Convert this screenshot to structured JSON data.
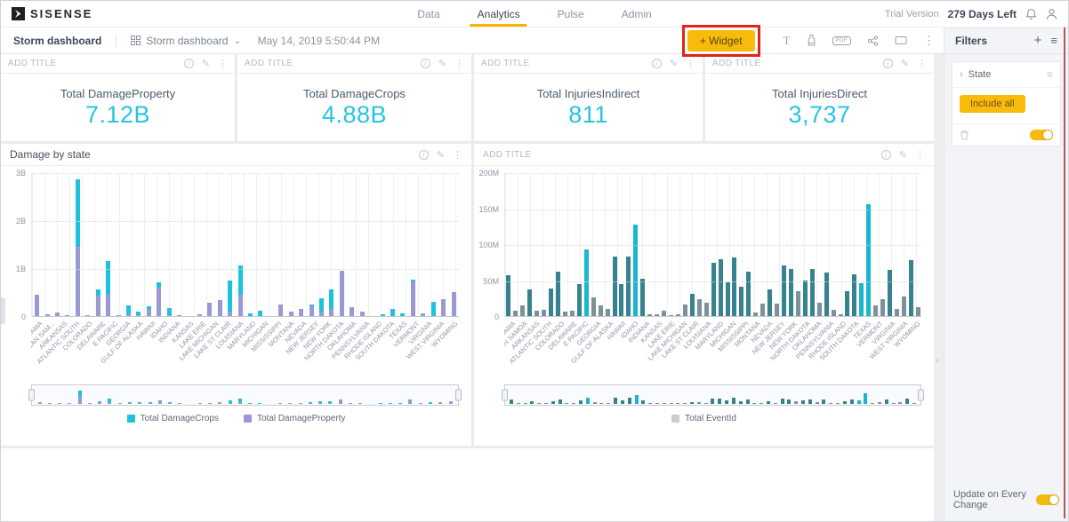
{
  "topnav": {
    "brand": "SISENSE",
    "tabs": [
      {
        "label": "Data"
      },
      {
        "label": "Analytics"
      },
      {
        "label": "Pulse"
      },
      {
        "label": "Admin"
      }
    ],
    "active_tab": "Analytics",
    "trial_label": "Trial Version",
    "trial_days": "279 Days Left"
  },
  "toolbar": {
    "breadcrumb": "Storm dashboard",
    "dashboard_selector": "Storm dashboard",
    "timestamp": "May 14, 2019 5:50:44 PM",
    "widget_button": "+ Widget"
  },
  "icons": {
    "info": "i",
    "edit": "✎",
    "dots": "⋮",
    "plus": "+",
    "hamburger": "≡",
    "caret_down": "⌄",
    "chevron_right": "›",
    "text_widget": "T",
    "pdf": "PDF"
  },
  "kpis": [
    {
      "header": "ADD TITLE",
      "label": "Total DamageProperty",
      "value": "7.12B"
    },
    {
      "header": "ADD TITLE",
      "label": "Total DamageCrops",
      "value": "4.88B"
    },
    {
      "header": "ADD TITLE",
      "label": "Total InjuriesIndirect",
      "value": "811"
    },
    {
      "header": "ADD TITLE",
      "label": "Total InjuriesDirect",
      "value": "3,737"
    }
  ],
  "filters": {
    "title": "Filters",
    "groups": [
      {
        "name": "State",
        "chip": "Include all"
      }
    ],
    "footer_label": "Update on Every Change",
    "update_on": true
  },
  "colors": {
    "accent_yellow": "#f8ba0b",
    "kpi_cyan": "#27c4e0",
    "property_purple": "#9a99d4",
    "crops_cyan": "#1dc3dc",
    "teal": "#37828f",
    "teal_gray": "#7d9298",
    "teal_bright": "#19b7cf",
    "legend_gray": "#c9ced3",
    "annotation_red": "#e3231a"
  },
  "chart_data": [
    {
      "type": "bar",
      "stacked": true,
      "title": "Damage by state",
      "ymax": 3,
      "y_unit": "B",
      "yticks": [
        "3B",
        "2B",
        "1B",
        "0"
      ],
      "grid": true,
      "legend_position": "bottom",
      "categories": [
        "ALABAMA",
        "AMERICAN SAM...",
        "ARKANSAS",
        "ATLANTIC SOUTH",
        "COLORADO",
        "DELAWARE",
        "E PACIFIC",
        "GEORGIA",
        "GULF OF ALASKA",
        "HAWAII",
        "IDAHO",
        "INDIANA",
        "KANSAS",
        "LAKE ERIE",
        "LAKE MICHIGAN",
        "LAKE ST CLAIR",
        "LOUISIANA",
        "MARYLAND",
        "MICHIGAN",
        "MISSISSIPPI",
        "MONTANA",
        "NEVADA",
        "NEW JERSEY",
        "NEW YORK",
        "NORTH DAKOTA",
        "OKLAHOMA",
        "PENNSYLVANIA",
        "RHODE ISLAND",
        "SOUTH DAKOTA",
        "TEXAS",
        "VERMONT",
        "VIRGINIA",
        "WEST VIRGINIA",
        "WYOMING"
      ],
      "series": [
        {
          "name": "Total DamageProperty",
          "color": "#9a99d4",
          "values": [
            0.45,
            0.03,
            0.08,
            0.02,
            1.45,
            0.02,
            0.42,
            0.45,
            0.02,
            0.04,
            0.02,
            0.15,
            0.6,
            0.02,
            0.02,
            0,
            0.04,
            0.28,
            0.33,
            0.1,
            0.45,
            0,
            0,
            0,
            0.25,
            0.1,
            0.15,
            0.2,
            0.08,
            0.15,
            0.95,
            0.18,
            0.1,
            0,
            0,
            0,
            0,
            0.72,
            0.06,
            0,
            0.35,
            0.5
          ]
        },
        {
          "name": "Total DamageCrops",
          "color": "#1dc3dc",
          "values": [
            0,
            0,
            0,
            0,
            1.4,
            0,
            0.13,
            0.7,
            0,
            0.18,
            0.08,
            0.05,
            0.1,
            0.15,
            0,
            0,
            0,
            0,
            0,
            0.65,
            0.6,
            0.05,
            0.12,
            0,
            0,
            0,
            0,
            0.05,
            0.3,
            0.4,
            0,
            0,
            0,
            0,
            0.04,
            0.15,
            0.05,
            0.04,
            0,
            0.3,
            0,
            0
          ]
        }
      ]
    },
    {
      "type": "bar",
      "stacked": false,
      "title": "ADD TITLE",
      "ymax": 200,
      "y_unit": "M",
      "yticks": [
        "200M",
        "150M",
        "100M",
        "50M",
        "0"
      ],
      "grid": true,
      "legend_position": "bottom",
      "legend_swatch": "#c9ced3",
      "categories": [
        "ALABAMA",
        "AMERICAN SAMOA",
        "ARKANSAS",
        "ATLANTIC SOUTH",
        "COLORADO",
        "DELAWARE",
        "E PACIFIC",
        "GEORGIA",
        "GULF OF ALASKA",
        "HAWAII",
        "IDAHO",
        "INDIANA",
        "KANSAS",
        "LAKE ERIE",
        "LAKE MICHIGAN",
        "LAKE ST CLAIR",
        "LOUISIANA",
        "MARYLAND",
        "MICHIGAN",
        "MISSISSIPPI",
        "MONTANA",
        "NEVADA",
        "NEW JERSEY",
        "NEW YORK",
        "NORTH DAKOTA",
        "OKLAHOMA",
        "PENNSYLVANIA",
        "RHODE ISLAND",
        "SOUTH DAKOTA",
        "TEXAS",
        "VERMONT",
        "VIRGINIA",
        "WEST VIRGINIA",
        "WYOMING"
      ],
      "series": [
        {
          "name": "Total EventId",
          "values": [
            57,
            8,
            15,
            37,
            8,
            9,
            38,
            62,
            6,
            7,
            44,
            92,
            26,
            15,
            10,
            83,
            44,
            83,
            127,
            52,
            2,
            3,
            8,
            1,
            2,
            16,
            31,
            24,
            18,
            74,
            79,
            47,
            82,
            41,
            62,
            5,
            17,
            37,
            17,
            71,
            65,
            34,
            50,
            66,
            19,
            61,
            9,
            2,
            35,
            58,
            46,
            156,
            15,
            23,
            64,
            10,
            27,
            78,
            12
          ],
          "colors": [
            "t",
            "g",
            "g",
            "t",
            "g",
            "g",
            "t",
            "t",
            "g",
            "g",
            "t",
            "b",
            "g",
            "g",
            "g",
            "t",
            "t",
            "t",
            "b",
            "t",
            "g",
            "g",
            "g",
            "g",
            "g",
            "g",
            "t",
            "g",
            "g",
            "t",
            "t",
            "t",
            "t",
            "t",
            "t",
            "g",
            "g",
            "t",
            "g",
            "t",
            "t",
            "g",
            "t",
            "t",
            "g",
            "t",
            "g",
            "g",
            "t",
            "t",
            "b",
            "b",
            "g",
            "g",
            "t",
            "g",
            "g",
            "t",
            "g"
          ]
        }
      ]
    }
  ]
}
